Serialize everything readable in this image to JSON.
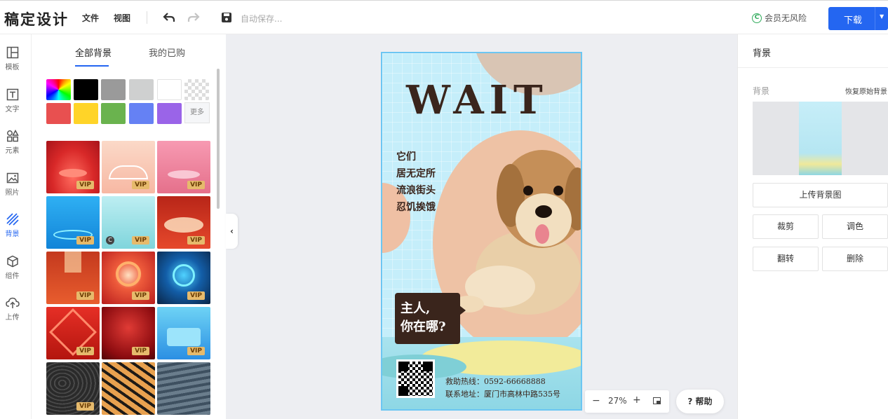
{
  "app": {
    "logo": "稿定设计",
    "menu": [
      "文件",
      "视图"
    ],
    "autosave": "自动保存...",
    "member": "会员无风险",
    "download": "下载"
  },
  "leftnav": [
    "模板",
    "文字",
    "元素",
    "照片",
    "背景",
    "组件",
    "上传"
  ],
  "panel": {
    "tabs": [
      "全部背景",
      "我的已购"
    ],
    "swatches": [
      "rainbow",
      "#000000",
      "#9a9a9a",
      "#cfd0d0",
      "#ffffff",
      "transparent",
      "#e85050",
      "#ffd428",
      "#6ab34e",
      "#6581f4",
      "#9a64e8"
    ],
    "more": "更多",
    "vip": "VIP",
    "copyright_mark": "C"
  },
  "poster": {
    "title": "WAIT",
    "lines": [
      "它们",
      "居无定所",
      "流浪街头",
      "忍饥挨饿"
    ],
    "bubble": [
      "主人,",
      "你在哪?"
    ],
    "hotline": "救助热线：0592-66668888",
    "address": "联系地址：厦门市高林中路535号"
  },
  "zoom": {
    "value": "27%",
    "minus": "−",
    "plus": "+"
  },
  "help": "? 帮助",
  "right": {
    "title": "背景",
    "label": "背景",
    "restore": "恢复原始背景",
    "upload": "上传背景图",
    "crop": "裁剪",
    "adjust": "调色",
    "flip": "翻转",
    "delete": "删除"
  },
  "colors": {
    "accent": "#2466f1",
    "canvas_bg": "#edeef2",
    "poster_frame": "#6cc6f2"
  }
}
